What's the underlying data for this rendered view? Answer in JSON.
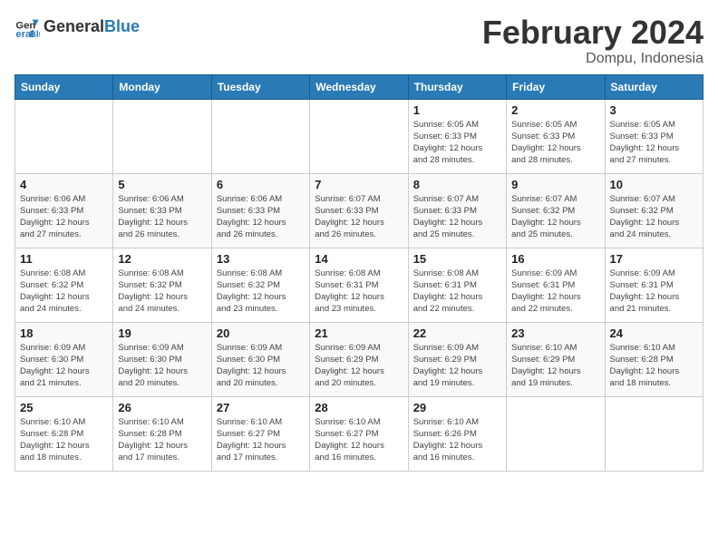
{
  "header": {
    "logo_line1": "General",
    "logo_line2": "Blue",
    "title": "February 2024",
    "subtitle": "Dompu, Indonesia"
  },
  "weekdays": [
    "Sunday",
    "Monday",
    "Tuesday",
    "Wednesday",
    "Thursday",
    "Friday",
    "Saturday"
  ],
  "weeks": [
    [
      {
        "day": "",
        "info": ""
      },
      {
        "day": "",
        "info": ""
      },
      {
        "day": "",
        "info": ""
      },
      {
        "day": "",
        "info": ""
      },
      {
        "day": "1",
        "info": "Sunrise: 6:05 AM\nSunset: 6:33 PM\nDaylight: 12 hours\nand 28 minutes."
      },
      {
        "day": "2",
        "info": "Sunrise: 6:05 AM\nSunset: 6:33 PM\nDaylight: 12 hours\nand 28 minutes."
      },
      {
        "day": "3",
        "info": "Sunrise: 6:05 AM\nSunset: 6:33 PM\nDaylight: 12 hours\nand 27 minutes."
      }
    ],
    [
      {
        "day": "4",
        "info": "Sunrise: 6:06 AM\nSunset: 6:33 PM\nDaylight: 12 hours\nand 27 minutes."
      },
      {
        "day": "5",
        "info": "Sunrise: 6:06 AM\nSunset: 6:33 PM\nDaylight: 12 hours\nand 26 minutes."
      },
      {
        "day": "6",
        "info": "Sunrise: 6:06 AM\nSunset: 6:33 PM\nDaylight: 12 hours\nand 26 minutes."
      },
      {
        "day": "7",
        "info": "Sunrise: 6:07 AM\nSunset: 6:33 PM\nDaylight: 12 hours\nand 26 minutes."
      },
      {
        "day": "8",
        "info": "Sunrise: 6:07 AM\nSunset: 6:33 PM\nDaylight: 12 hours\nand 25 minutes."
      },
      {
        "day": "9",
        "info": "Sunrise: 6:07 AM\nSunset: 6:32 PM\nDaylight: 12 hours\nand 25 minutes."
      },
      {
        "day": "10",
        "info": "Sunrise: 6:07 AM\nSunset: 6:32 PM\nDaylight: 12 hours\nand 24 minutes."
      }
    ],
    [
      {
        "day": "11",
        "info": "Sunrise: 6:08 AM\nSunset: 6:32 PM\nDaylight: 12 hours\nand 24 minutes."
      },
      {
        "day": "12",
        "info": "Sunrise: 6:08 AM\nSunset: 6:32 PM\nDaylight: 12 hours\nand 24 minutes."
      },
      {
        "day": "13",
        "info": "Sunrise: 6:08 AM\nSunset: 6:32 PM\nDaylight: 12 hours\nand 23 minutes."
      },
      {
        "day": "14",
        "info": "Sunrise: 6:08 AM\nSunset: 6:31 PM\nDaylight: 12 hours\nand 23 minutes."
      },
      {
        "day": "15",
        "info": "Sunrise: 6:08 AM\nSunset: 6:31 PM\nDaylight: 12 hours\nand 22 minutes."
      },
      {
        "day": "16",
        "info": "Sunrise: 6:09 AM\nSunset: 6:31 PM\nDaylight: 12 hours\nand 22 minutes."
      },
      {
        "day": "17",
        "info": "Sunrise: 6:09 AM\nSunset: 6:31 PM\nDaylight: 12 hours\nand 21 minutes."
      }
    ],
    [
      {
        "day": "18",
        "info": "Sunrise: 6:09 AM\nSunset: 6:30 PM\nDaylight: 12 hours\nand 21 minutes."
      },
      {
        "day": "19",
        "info": "Sunrise: 6:09 AM\nSunset: 6:30 PM\nDaylight: 12 hours\nand 20 minutes."
      },
      {
        "day": "20",
        "info": "Sunrise: 6:09 AM\nSunset: 6:30 PM\nDaylight: 12 hours\nand 20 minutes."
      },
      {
        "day": "21",
        "info": "Sunrise: 6:09 AM\nSunset: 6:29 PM\nDaylight: 12 hours\nand 20 minutes."
      },
      {
        "day": "22",
        "info": "Sunrise: 6:09 AM\nSunset: 6:29 PM\nDaylight: 12 hours\nand 19 minutes."
      },
      {
        "day": "23",
        "info": "Sunrise: 6:10 AM\nSunset: 6:29 PM\nDaylight: 12 hours\nand 19 minutes."
      },
      {
        "day": "24",
        "info": "Sunrise: 6:10 AM\nSunset: 6:28 PM\nDaylight: 12 hours\nand 18 minutes."
      }
    ],
    [
      {
        "day": "25",
        "info": "Sunrise: 6:10 AM\nSunset: 6:28 PM\nDaylight: 12 hours\nand 18 minutes."
      },
      {
        "day": "26",
        "info": "Sunrise: 6:10 AM\nSunset: 6:28 PM\nDaylight: 12 hours\nand 17 minutes."
      },
      {
        "day": "27",
        "info": "Sunrise: 6:10 AM\nSunset: 6:27 PM\nDaylight: 12 hours\nand 17 minutes."
      },
      {
        "day": "28",
        "info": "Sunrise: 6:10 AM\nSunset: 6:27 PM\nDaylight: 12 hours\nand 16 minutes."
      },
      {
        "day": "29",
        "info": "Sunrise: 6:10 AM\nSunset: 6:26 PM\nDaylight: 12 hours\nand 16 minutes."
      },
      {
        "day": "",
        "info": ""
      },
      {
        "day": "",
        "info": ""
      }
    ]
  ]
}
